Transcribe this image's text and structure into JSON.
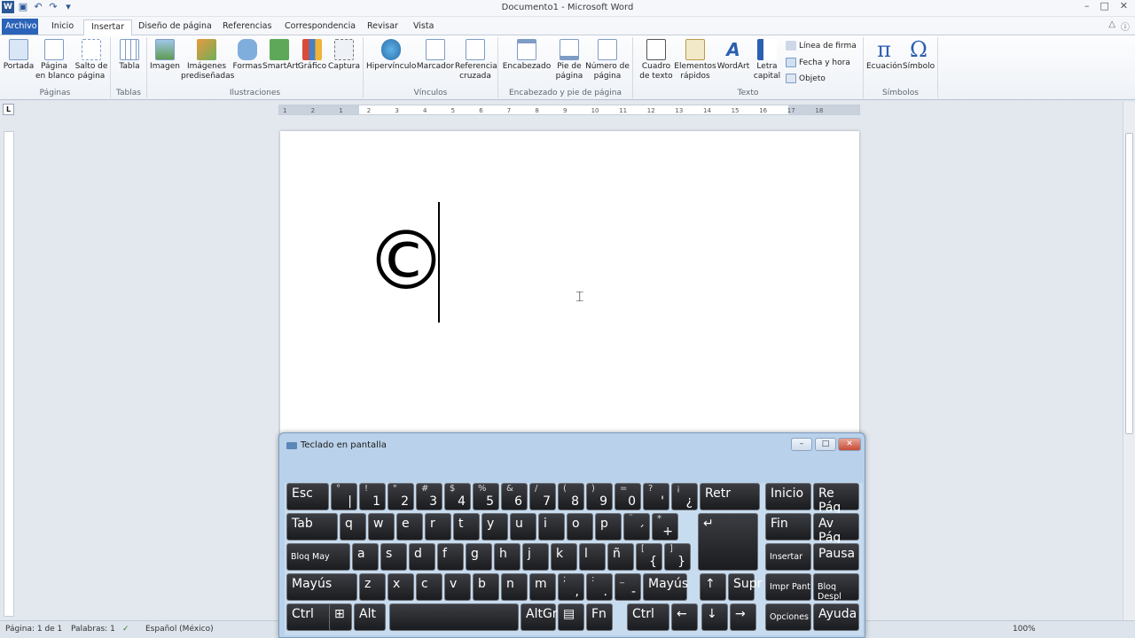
{
  "window": {
    "title": "Documento1 - Microsoft Word",
    "controls": [
      "–",
      "□",
      "✕"
    ]
  },
  "qat": {
    "undo": "↶",
    "redo": "↷",
    "more": "▾",
    "app_badge": "W"
  },
  "tabs": [
    "Archivo",
    "Inicio",
    "Insertar",
    "Diseño de página",
    "Referencias",
    "Correspondencia",
    "Revisar",
    "Vista"
  ],
  "ribbon": {
    "groups": {
      "paginas": "Páginas",
      "tablas": "Tablas",
      "ilustraciones": "Ilustraciones",
      "vinculos": "Vínculos",
      "encabezado": "Encabezado y pie de página",
      "texto": "Texto",
      "simbolos": "Símbolos"
    },
    "buttons": {
      "portada": "Portada",
      "pagina_blanco": "Página\nen blanco",
      "salto": "Salto de\npágina",
      "tabla": "Tabla",
      "imagen": "Imagen",
      "imagenes_pred": "Imágenes\nprediseñadas",
      "formas": "Formas",
      "smartart": "SmartArt",
      "grafico": "Gráfico",
      "captura": "Captura",
      "hipervinculo": "Hipervínculo",
      "marcador": "Marcador",
      "referencia": "Referencia\ncruzada",
      "encabezado": "Encabezado",
      "pie": "Pie de\npágina",
      "numero": "Número de\npágina",
      "cuadro": "Cuadro\nde texto",
      "elementos": "Elementos\nrápidos",
      "wordart": "WordArt",
      "letra": "Letra\ncapital",
      "ecuacion": "Ecuación",
      "simbolo": "Símbolo",
      "linea_firma": "Línea de firma",
      "fecha_hora": "Fecha y hora",
      "objeto": "Objeto"
    },
    "glyphs": {
      "ecuacion": "π",
      "simbolo": "Ω"
    }
  },
  "ruler": {
    "ticks": [
      "1",
      "2",
      "1",
      "2",
      "3",
      "4",
      "5",
      "6",
      "7",
      "8",
      "9",
      "10",
      "11",
      "12",
      "13",
      "14",
      "15",
      "16",
      "17",
      "18"
    ],
    "tab_selector": "L"
  },
  "document": {
    "content": "©"
  },
  "status": {
    "page": "Página: 1 de 1",
    "words": "Palabras: 1",
    "language": "Español (México)",
    "zoom": "100%"
  },
  "osk": {
    "title": "Teclado en pantalla",
    "rows": [
      [
        {
          "t": "",
          "b": "",
          "main": "Esc"
        },
        {
          "t": "°",
          "b": "|"
        },
        {
          "t": "!",
          "b": "1"
        },
        {
          "t": "\"",
          "b": "2"
        },
        {
          "t": "#",
          "b": "3"
        },
        {
          "t": "$",
          "b": "4"
        },
        {
          "t": "%",
          "b": "5"
        },
        {
          "t": "&",
          "b": "6"
        },
        {
          "t": "/",
          "b": "7"
        },
        {
          "t": "(",
          "b": "8"
        },
        {
          "t": ")",
          "b": "9"
        },
        {
          "t": "=",
          "b": "0"
        },
        {
          "t": "?",
          "b": "'"
        },
        {
          "t": "¡",
          "b": "¿"
        },
        {
          "main": "Retr"
        },
        {
          "main": "Inicio"
        },
        {
          "main": "Re Pág"
        }
      ],
      [
        {
          "main": "Tab"
        },
        {
          "main": "q"
        },
        {
          "main": "w"
        },
        {
          "main": "e"
        },
        {
          "main": "r"
        },
        {
          "main": "t"
        },
        {
          "main": "y"
        },
        {
          "main": "u"
        },
        {
          "main": "i"
        },
        {
          "main": "o"
        },
        {
          "main": "p"
        },
        {
          "t": "¨",
          "b": "´"
        },
        {
          "t": "*",
          "b": "+"
        },
        {
          "main": "↵"
        },
        {
          "main": "Fin"
        },
        {
          "main": "Av Pág"
        }
      ],
      [
        {
          "main": "Bloq May"
        },
        {
          "main": "a"
        },
        {
          "main": "s"
        },
        {
          "main": "d"
        },
        {
          "main": "f"
        },
        {
          "main": "g"
        },
        {
          "main": "h"
        },
        {
          "main": "j"
        },
        {
          "main": "k"
        },
        {
          "main": "l"
        },
        {
          "main": "ñ"
        },
        {
          "t": "[",
          "b": "{"
        },
        {
          "t": "]",
          "b": "}"
        },
        {
          "main": "Insertar"
        },
        {
          "main": "Pausa"
        }
      ],
      [
        {
          "main": "Mayús"
        },
        {
          "main": "z"
        },
        {
          "main": "x"
        },
        {
          "main": "c"
        },
        {
          "main": "v"
        },
        {
          "main": "b"
        },
        {
          "main": "n"
        },
        {
          "main": "m"
        },
        {
          "t": ";",
          "b": ","
        },
        {
          "t": ":",
          "b": "."
        },
        {
          "t": "_",
          "b": "-"
        },
        {
          "main": "Mayús"
        },
        {
          "main": "↑"
        },
        {
          "main": "Supr"
        },
        {
          "main": "Impr Pant"
        },
        {
          "main": "Bloq Despl"
        }
      ],
      [
        {
          "main": "Ctrl"
        },
        {
          "main": "⊞"
        },
        {
          "main": "Alt"
        },
        {
          "main": ""
        },
        {
          "main": "AltGr"
        },
        {
          "main": "▤"
        },
        {
          "main": "Fn"
        },
        {
          "main": "Ctrl"
        },
        {
          "main": "←"
        },
        {
          "main": "↓"
        },
        {
          "main": "→"
        },
        {
          "main": "Opciones"
        },
        {
          "main": "Ayuda"
        }
      ]
    ]
  },
  "colors": {
    "file_tab": "#2a63b8",
    "key": "#1b1c1f",
    "osk_frame": "#b9d1ea"
  }
}
